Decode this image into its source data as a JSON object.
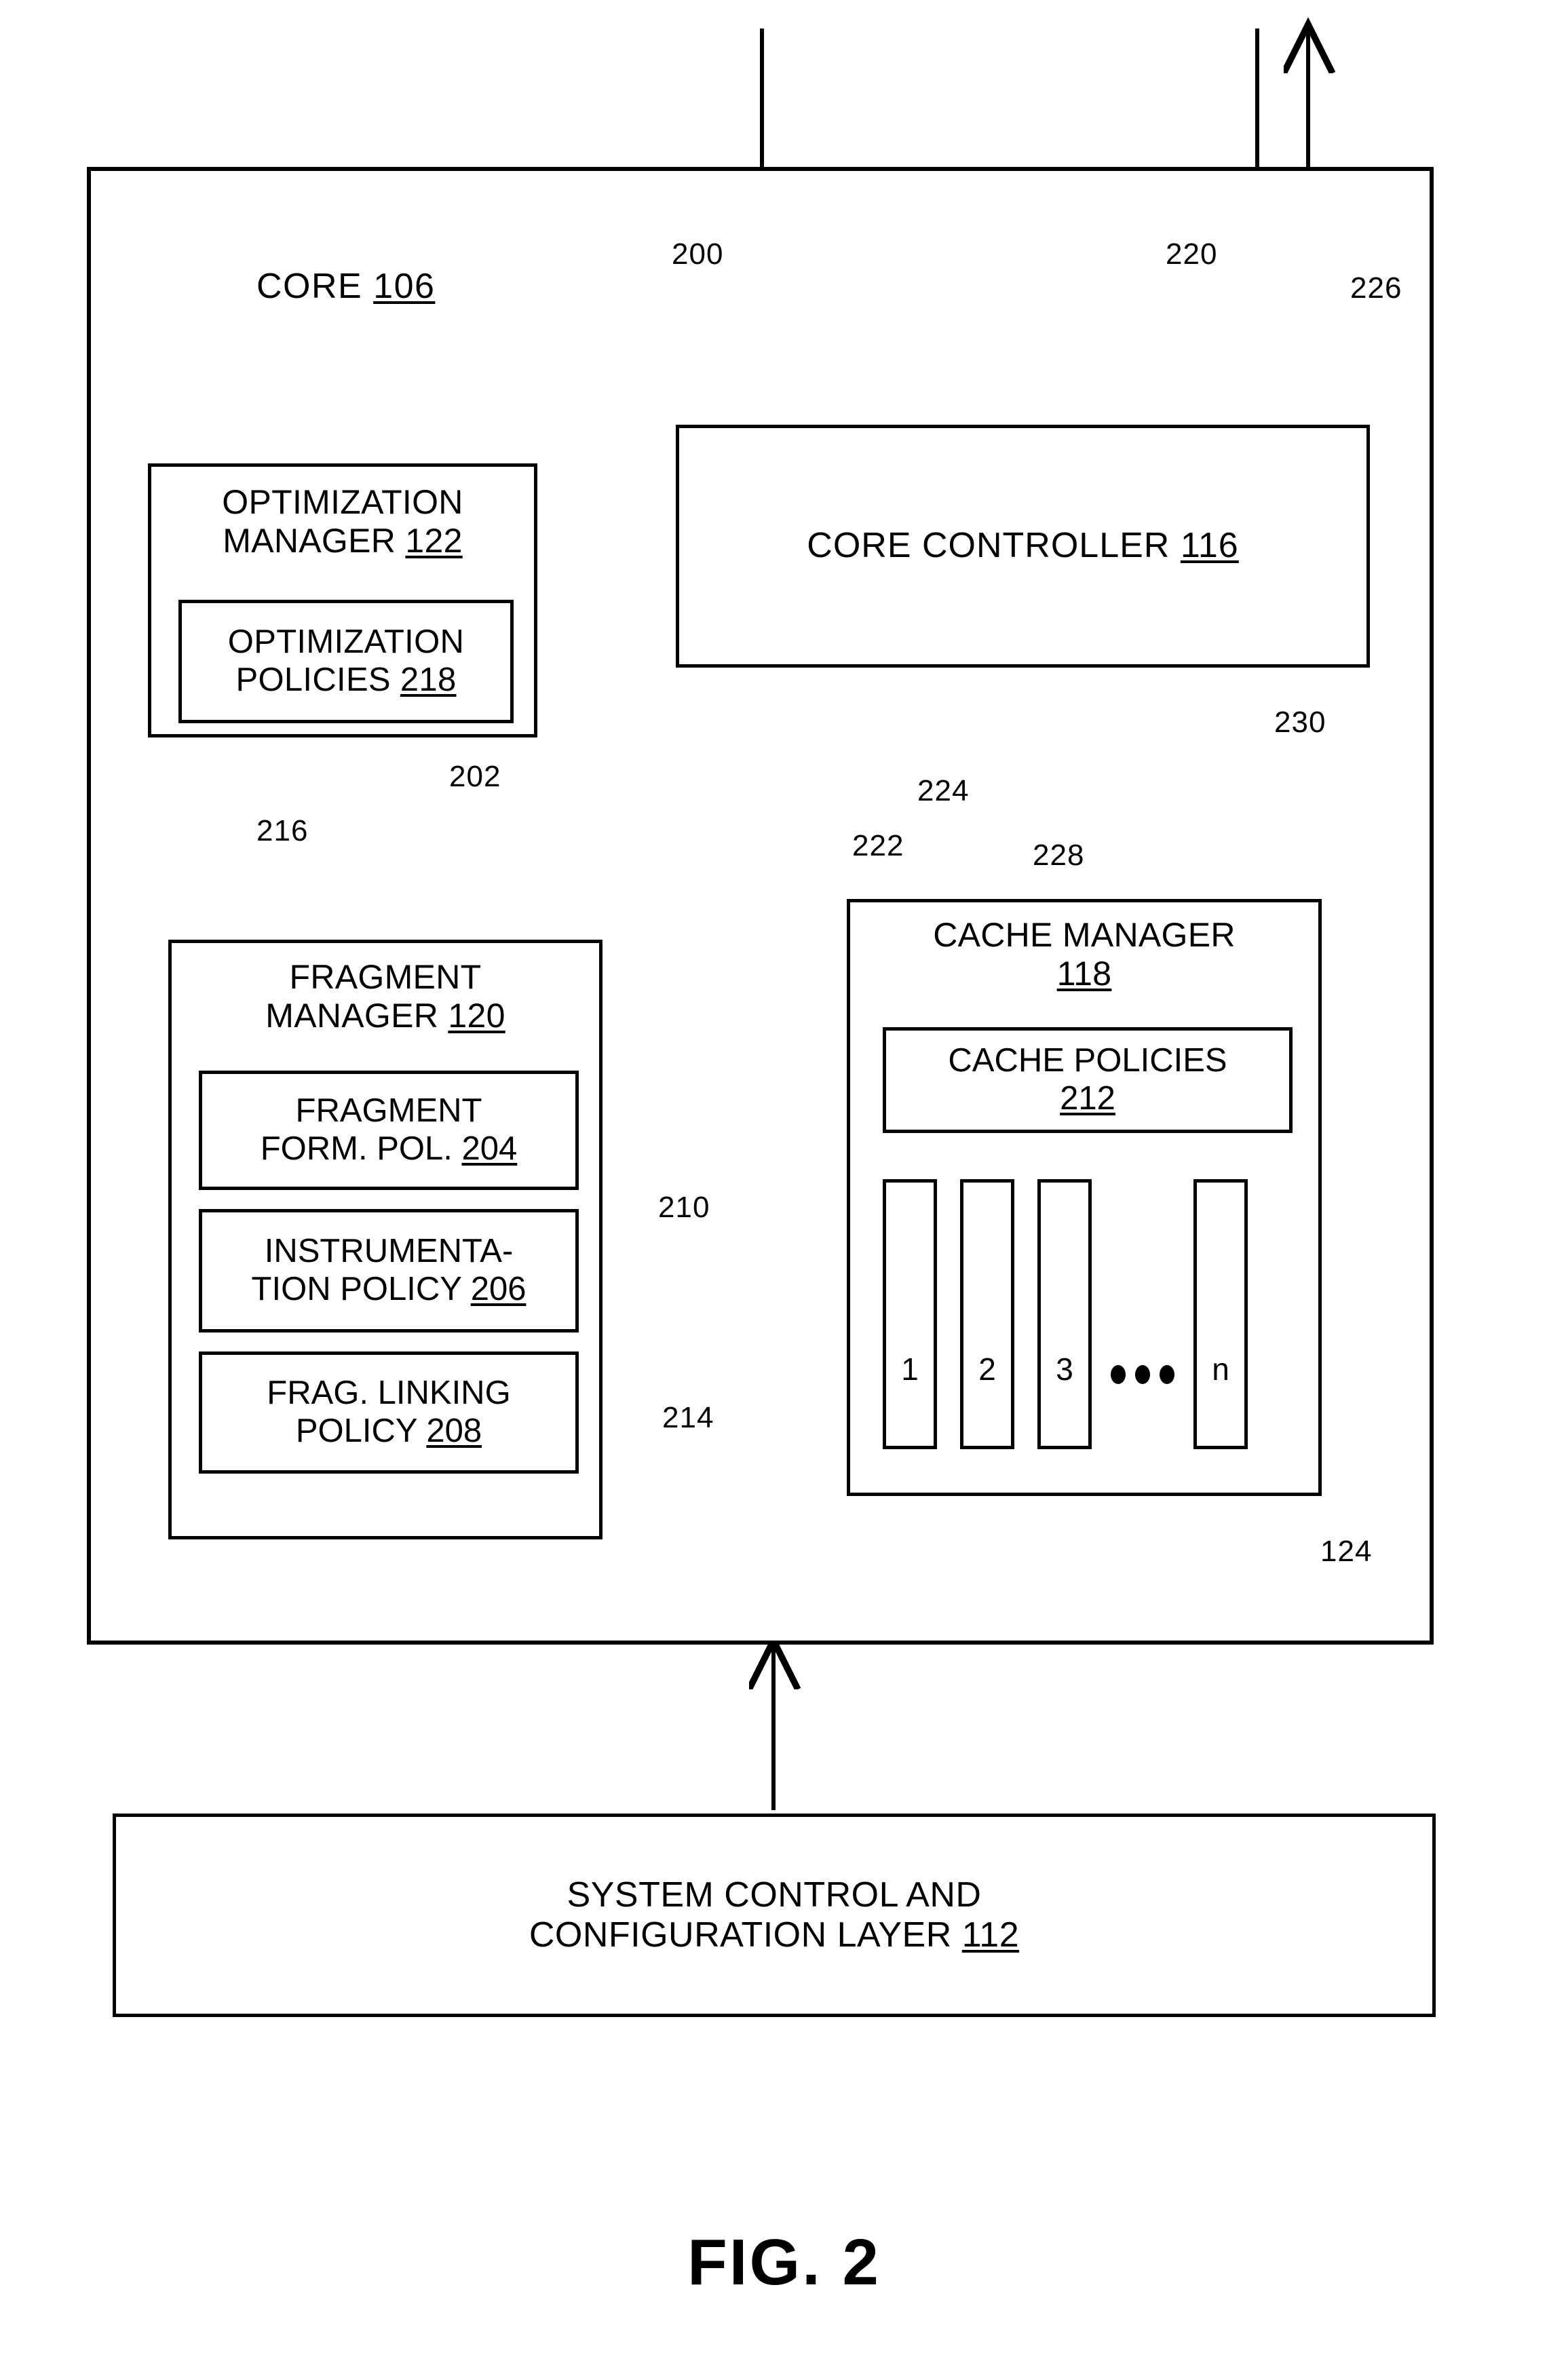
{
  "figure": {
    "caption": "FIG. 2"
  },
  "core": {
    "label_text": "CORE",
    "label_ref": "106"
  },
  "core_controller": {
    "label_text": "CORE CONTROLLER",
    "label_ref": "116"
  },
  "optimization_manager": {
    "line1": "OPTIMIZATION",
    "line2": "MANAGER",
    "ref": "122",
    "policies": {
      "line1": "OPTIMIZATION",
      "line2": "POLICIES",
      "ref": "218"
    }
  },
  "fragment_manager": {
    "line1": "FRAGMENT",
    "line2": "MANAGER",
    "ref": "120",
    "policies": [
      {
        "line1": "FRAGMENT",
        "line2": "FORM. POL.",
        "ref": "204"
      },
      {
        "line1": "INSTRUMENTA-",
        "line2": "TION POLICY",
        "ref": "206"
      },
      {
        "line1": "FRAG. LINKING",
        "line2": "POLICY",
        "ref": "208"
      }
    ]
  },
  "cache_manager": {
    "line1": "CACHE MANAGER",
    "ref": "118",
    "policies": {
      "line1": "CACHE POLICIES",
      "ref": "212"
    },
    "slots": [
      "1",
      "2",
      "3",
      "n"
    ],
    "ellipsis": "•••"
  },
  "system_layer": {
    "line1": "SYSTEM CONTROL AND",
    "line2": "CONFIGURATION LAYER",
    "ref": "112"
  },
  "reference_numerals": {
    "n200": "200",
    "n220": "220",
    "n226": "226",
    "n230": "230",
    "n224": "224",
    "n222": "222",
    "n228": "228",
    "n216": "216",
    "n202": "202",
    "n210": "210",
    "n214": "214",
    "n124": "124"
  },
  "style": {
    "line_color": "#000000",
    "background": "#ffffff"
  }
}
